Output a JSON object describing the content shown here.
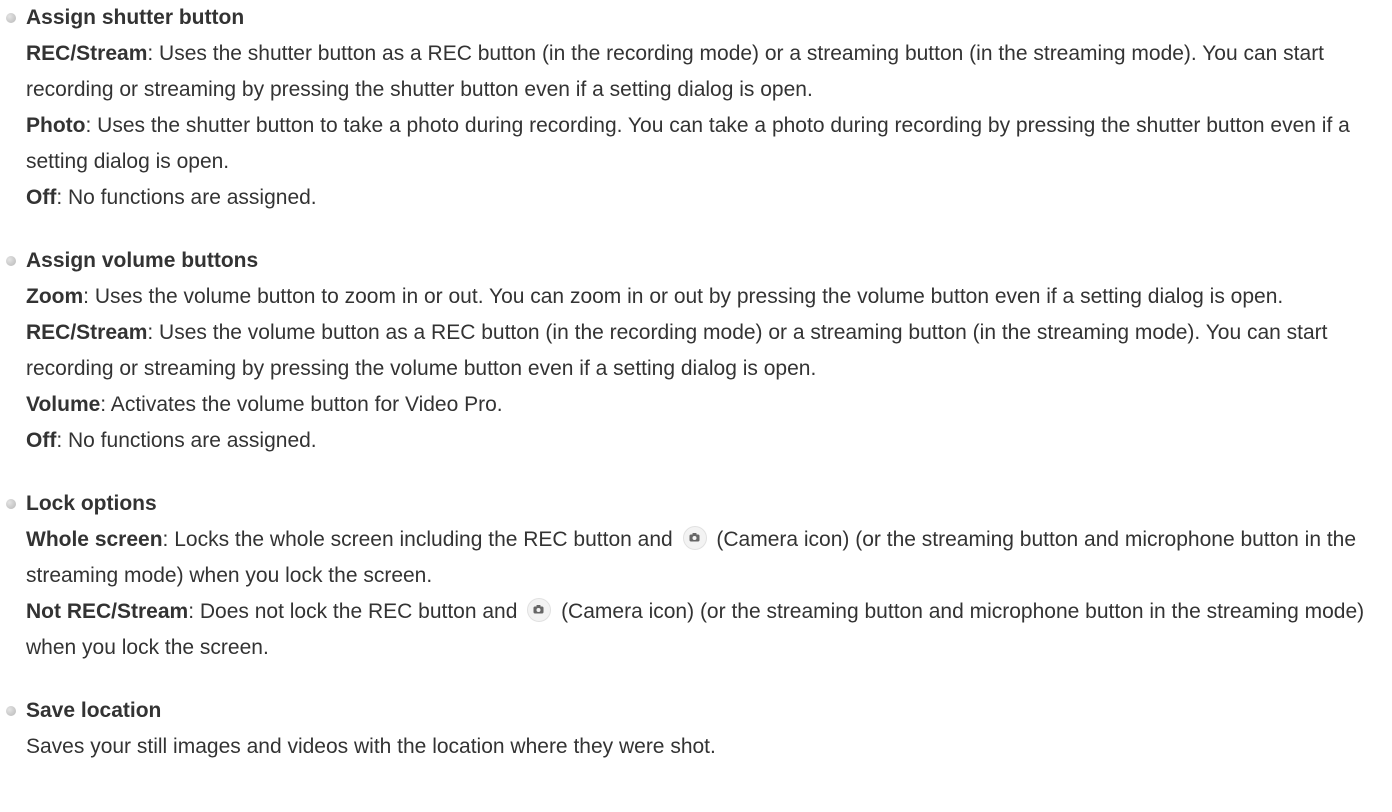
{
  "sections": [
    {
      "title": "Assign shutter button",
      "items": [
        {
          "term": "REC/Stream",
          "text": ": Uses the shutter button as a REC button (in the recording mode) or a streaming button (in the streaming mode). You can start recording or streaming by pressing the shutter button even if a setting dialog is open."
        },
        {
          "term": "Photo",
          "text": ": Uses the shutter button to take a photo during recording. You can take a photo during recording by pressing the shutter button even if a setting dialog is open."
        },
        {
          "term": "Off",
          "text": ": No functions are assigned."
        }
      ]
    },
    {
      "title": "Assign volume buttons",
      "items": [
        {
          "term": "Zoom",
          "text": ": Uses the volume button to zoom in or out. You can zoom in or out by pressing the volume button even if a setting dialog is open."
        },
        {
          "term": "REC/Stream",
          "text": ": Uses the volume button as a REC button (in the recording mode) or a streaming button (in the streaming mode). You can start recording or streaming by pressing the volume button even if a setting dialog is open."
        },
        {
          "term": "Volume",
          "text": ": Activates the volume button for Video Pro."
        },
        {
          "term": "Off",
          "text": ": No functions are assigned."
        }
      ]
    },
    {
      "title": "Lock options",
      "items": [
        {
          "term": "Whole screen",
          "text_before": ": Locks the whole screen including the REC button and ",
          "icon": "camera-icon",
          "text_after": " (Camera icon) (or the streaming button and microphone button in the streaming mode) when you lock the screen."
        },
        {
          "term": "Not REC/Stream",
          "text_before": ": Does not lock the REC button and ",
          "icon": "camera-icon",
          "text_after": " (Camera icon) (or the streaming button and microphone button in the streaming mode) when you lock the screen."
        }
      ]
    },
    {
      "title": "Save location",
      "items": [
        {
          "text": "Saves your still images and videos with the location where they were shot."
        }
      ]
    }
  ]
}
